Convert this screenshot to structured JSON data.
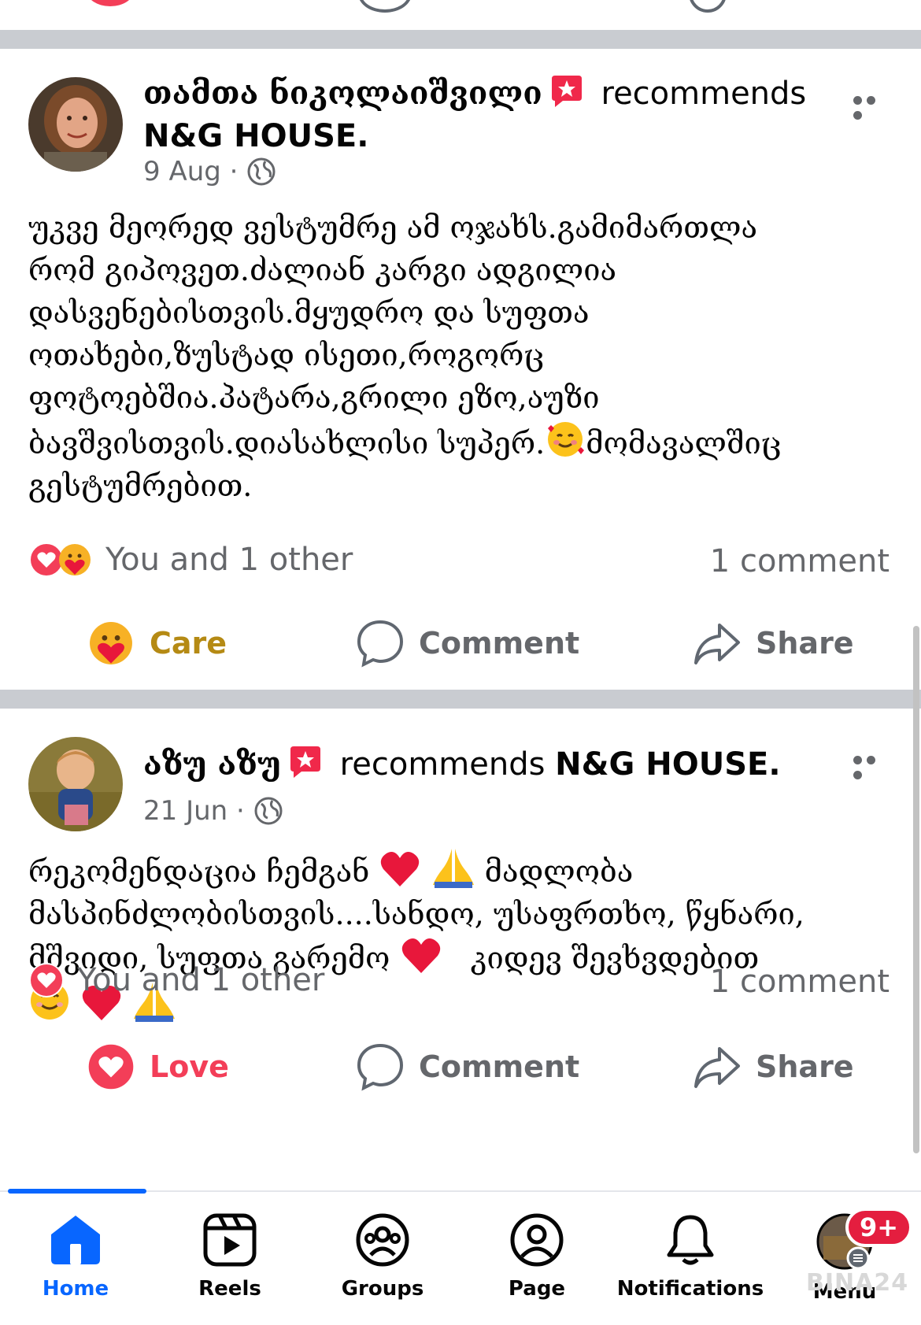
{
  "posts": [
    {
      "author": "თამთა ნიკოლაიშვილი",
      "verb": "recommends",
      "page": "N&G HOUSE.",
      "date": "9 Aug",
      "dot": "·",
      "text_lines": [
        "უკვე მეორედ ვესტუმრე ამ ოჯახს.გამიმართლა",
        "რომ გიპოვეთ.ძალიან კარგი ადგილია",
        "დასვენებისთვის.მყუდრო და სუფთა",
        "ოთახები,ზუსტად ისეთი,როგორც",
        "ფოტოებშია.პატარა,გრილი ეზო,აუზი",
        "ბავშვისთვის.დიასახლისი სუპერ.",
        "მომავალშიც",
        "გესტუმრებით."
      ],
      "reactions_text": "You and 1 other",
      "comments_text": "1 comment",
      "actions": {
        "react": "Care",
        "comment": "Comment",
        "share": "Share"
      }
    },
    {
      "author": "აზუ აზუ",
      "verb": "recommends",
      "page": "N&G HOUSE.",
      "date": "21 Jun",
      "dot": "·",
      "text_lines": [
        "რეკომენდაცია ჩემგან",
        "მადლობა",
        "მასპინძლობისთვის....სანდო, უსაფრთხო, წყნარი,",
        "მშვიდი,  სუფთა გარემო",
        "კიდევ შევხვდებით"
      ],
      "reactions_text": "You and 1 other",
      "comments_text": "1 comment",
      "actions": {
        "react": "Love",
        "comment": "Comment",
        "share": "Share"
      }
    }
  ],
  "tabs": [
    {
      "label": "Home",
      "icon": "home-icon",
      "active": true
    },
    {
      "label": "Reels",
      "icon": "reels-icon"
    },
    {
      "label": "Groups",
      "icon": "groups-icon"
    },
    {
      "label": "Page",
      "icon": "page-icon"
    },
    {
      "label": "Notifications",
      "icon": "bell-icon"
    },
    {
      "label": "Menu",
      "icon": "menu-avatar-icon"
    }
  ],
  "menu_badge": "9+",
  "watermark": "BINA24",
  "colors": {
    "accent": "#0866ff",
    "love": "#f33e58",
    "care": "#e2a51d",
    "badge": "#e41e3f",
    "separator": "#c9ccd1",
    "muted": "#65676b"
  }
}
